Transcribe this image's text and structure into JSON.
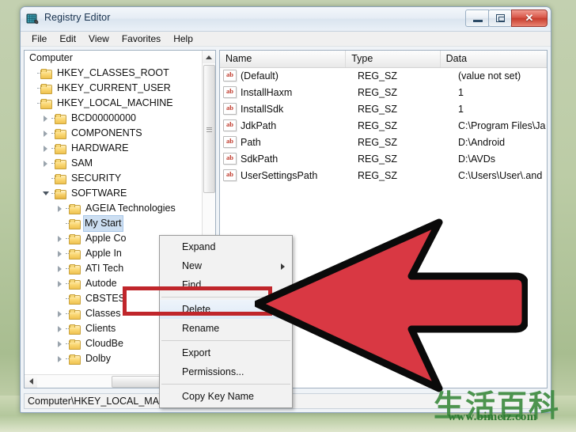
{
  "window": {
    "title": "Registry Editor",
    "icon": "registry-editor-icon",
    "controls": {
      "minimize": "minimize-button",
      "maximize": "maximize-button",
      "close_glyph": "✕"
    }
  },
  "menubar": {
    "items": [
      "File",
      "Edit",
      "View",
      "Favorites",
      "Help"
    ]
  },
  "tree": {
    "root": "Computer",
    "nodes": [
      {
        "label": "HKEY_CLASSES_ROOT",
        "indent": 0,
        "expander": "none",
        "selected": false
      },
      {
        "label": "HKEY_CURRENT_USER",
        "indent": 0,
        "expander": "none",
        "selected": false
      },
      {
        "label": "HKEY_LOCAL_MACHINE",
        "indent": 0,
        "expander": "none",
        "selected": false
      },
      {
        "label": "BCD00000000",
        "indent": 1,
        "expander": "closed",
        "selected": false
      },
      {
        "label": "COMPONENTS",
        "indent": 1,
        "expander": "closed",
        "selected": false
      },
      {
        "label": "HARDWARE",
        "indent": 1,
        "expander": "closed",
        "selected": false
      },
      {
        "label": "SAM",
        "indent": 1,
        "expander": "closed",
        "selected": false
      },
      {
        "label": "SECURITY",
        "indent": 1,
        "expander": "none",
        "selected": false
      },
      {
        "label": "SOFTWARE",
        "indent": 1,
        "expander": "open",
        "selected": false
      },
      {
        "label": "AGEIA Technologies",
        "indent": 2,
        "expander": "closed",
        "selected": false
      },
      {
        "label": "My Start",
        "indent": 2,
        "expander": "none",
        "selected": true
      },
      {
        "label": "Apple Co",
        "indent": 2,
        "expander": "closed",
        "selected": false
      },
      {
        "label": "Apple In",
        "indent": 2,
        "expander": "closed",
        "selected": false
      },
      {
        "label": "ATI Tech",
        "indent": 2,
        "expander": "closed",
        "selected": false
      },
      {
        "label": "Autode",
        "indent": 2,
        "expander": "closed",
        "selected": false
      },
      {
        "label": "CBSTES",
        "indent": 2,
        "expander": "none",
        "selected": false
      },
      {
        "label": "Classes",
        "indent": 2,
        "expander": "closed",
        "selected": false
      },
      {
        "label": "Clients",
        "indent": 2,
        "expander": "closed",
        "selected": false
      },
      {
        "label": "CloudBe",
        "indent": 2,
        "expander": "closed",
        "selected": false
      },
      {
        "label": "Dolby",
        "indent": 2,
        "expander": "closed",
        "selected": false
      }
    ]
  },
  "list": {
    "columns": [
      "Name",
      "Type",
      "Data"
    ],
    "rows": [
      {
        "icon": "ab-string-icon",
        "name": "(Default)",
        "type": "REG_SZ",
        "data": "(value not set)"
      },
      {
        "icon": "ab-string-icon",
        "name": "InstallHaxm",
        "type": "REG_SZ",
        "data": "1"
      },
      {
        "icon": "ab-string-icon",
        "name": "InstallSdk",
        "type": "REG_SZ",
        "data": "1"
      },
      {
        "icon": "ab-string-icon",
        "name": "JdkPath",
        "type": "REG_SZ",
        "data": "C:\\Program Files\\Ja"
      },
      {
        "icon": "ab-string-icon",
        "name": "Path",
        "type": "REG_SZ",
        "data": "D:\\Android"
      },
      {
        "icon": "ab-string-icon",
        "name": "SdkPath",
        "type": "REG_SZ",
        "data": "D:\\AVDs"
      },
      {
        "icon": "ab-string-icon",
        "name": "UserSettingsPath",
        "type": "REG_SZ",
        "data": "C:\\Users\\User\\.and"
      }
    ],
    "icon_text": "ab"
  },
  "context_menu": {
    "items": [
      {
        "label": "Expand",
        "submenu": false,
        "highlighted": false,
        "separator_after": false
      },
      {
        "label": "New",
        "submenu": true,
        "highlighted": false,
        "separator_after": false
      },
      {
        "label": "Find...",
        "submenu": false,
        "highlighted": false,
        "separator_after": true
      },
      {
        "label": "Delete",
        "submenu": false,
        "highlighted": true,
        "separator_after": false
      },
      {
        "label": "Rename",
        "submenu": false,
        "highlighted": false,
        "separator_after": true
      },
      {
        "label": "Export",
        "submenu": false,
        "highlighted": false,
        "separator_after": false
      },
      {
        "label": "Permissions...",
        "submenu": false,
        "highlighted": false,
        "separator_after": true
      },
      {
        "label": "Copy Key Name",
        "submenu": false,
        "highlighted": false,
        "separator_after": false
      }
    ]
  },
  "statusbar": {
    "path": "Computer\\HKEY_LOCAL_MACHINE\\SOFTWARE\\My Start"
  },
  "annotation": {
    "arrow": "red-left-arrow",
    "highlight_target": "Delete",
    "highlight_color": "#c0262b",
    "arrow_fill": "#d93843",
    "arrow_stroke": "#0a0a0a"
  },
  "watermark": {
    "cjk": "生活百科",
    "url": "www.bimeiz.com",
    "color": "#2f7a33"
  }
}
